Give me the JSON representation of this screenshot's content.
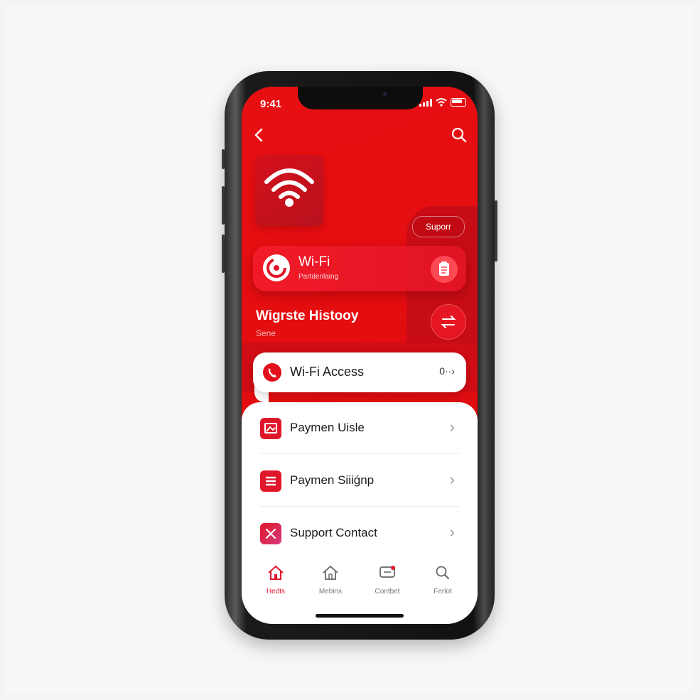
{
  "status": {
    "time": "9:41"
  },
  "hero": {
    "support_label": "Suporr"
  },
  "wifi_card": {
    "title": "Wi-Fi",
    "subtitle": "Partdenlaing"
  },
  "history": {
    "title": "Wigrste Histooy",
    "subtitle": "Sene"
  },
  "access": {
    "label": "Wi-Fi Access",
    "value": "0··›"
  },
  "list": {
    "items": [
      {
        "label": "Paymen Uisle"
      },
      {
        "label": "Paymen Siiiǵnp"
      },
      {
        "label": "Support Contact"
      }
    ]
  },
  "tabs": [
    {
      "label": "Hedts",
      "icon": "home-icon",
      "active": true
    },
    {
      "label": "Mebins",
      "icon": "house-icon",
      "active": false
    },
    {
      "label": "Contbet",
      "icon": "chat-icon",
      "active": false
    },
    {
      "label": "Ferlot",
      "icon": "search-icon",
      "active": false
    }
  ],
  "colors": {
    "accent": "#e40d10",
    "card_red": "#f21a28",
    "icon_red": "#e0172a"
  }
}
